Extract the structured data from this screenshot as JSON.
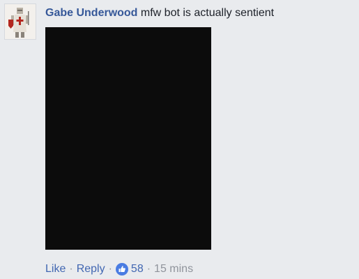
{
  "comment": {
    "author": "Gabe Underwood",
    "text": "mfw bot is actually sentient",
    "actions": {
      "like_label": "Like",
      "separator": "·",
      "reply_label": "Reply",
      "reaction_icon": "like-icon",
      "reaction_count": "58",
      "timestamp": "15 mins"
    }
  },
  "colors": {
    "page_background": "#e9ebee",
    "author_link": "#365899",
    "action_link": "#4267b2",
    "meta_text": "#90949c",
    "attachment": "#0c0c0c"
  }
}
